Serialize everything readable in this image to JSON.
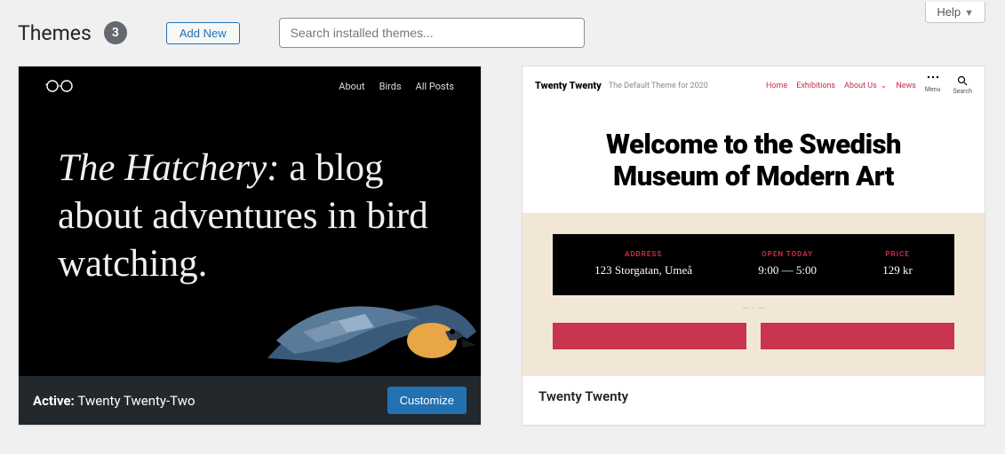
{
  "header": {
    "title": "Themes",
    "count": "3",
    "add_new": "Add New",
    "search_placeholder": "Search installed themes...",
    "help": "Help"
  },
  "themes": {
    "active": {
      "active_label": "Active:",
      "name": "Twenty Twenty-Two",
      "customize": "Customize",
      "preview": {
        "nav": [
          "About",
          "Birds",
          "All Posts"
        ],
        "headline_em": "The Hatchery:",
        "headline_rest": " a blog about adventures in bird watching."
      }
    },
    "second": {
      "name": "Twenty Twenty",
      "preview": {
        "brand": "Twenty Twenty",
        "tagline": "The Default Theme for 2020",
        "nav": [
          "Home",
          "Exhibitions",
          "About Us",
          "News"
        ],
        "menu_label": "Menu",
        "search_label": "Search",
        "hero_line1": "Welcome to the Swedish",
        "hero_line2": "Museum of Modern Art",
        "info": [
          {
            "label": "ADDRESS",
            "value": "123 Storgatan, Umeå"
          },
          {
            "label": "OPEN TODAY",
            "value": "9:00 — 5:00"
          },
          {
            "label": "PRICE",
            "value": "129 kr"
          }
        ]
      }
    }
  }
}
